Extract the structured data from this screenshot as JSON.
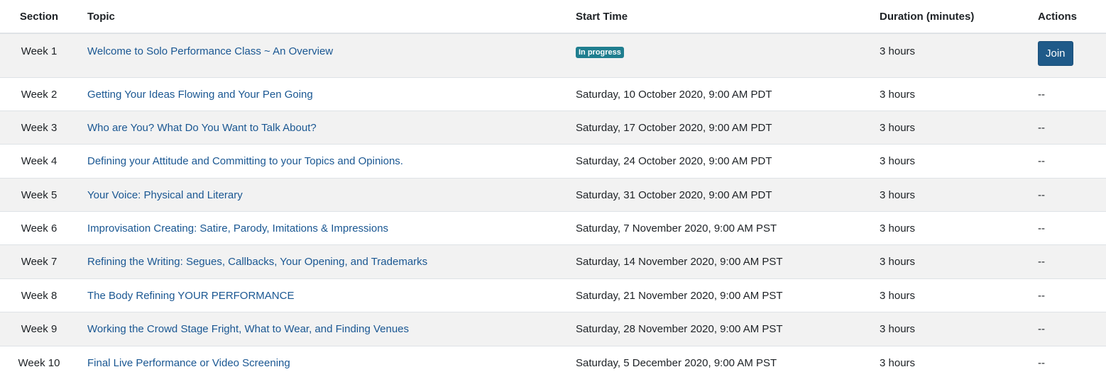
{
  "headers": {
    "section": "Section",
    "topic": "Topic",
    "start_time": "Start Time",
    "duration": "Duration (minutes)",
    "actions": "Actions"
  },
  "status_badge": "In progress",
  "join_label": "Join",
  "colors": {
    "badge": "#1f7e8f",
    "join_button": "#1f5a89",
    "link": "#1a5792"
  },
  "rows": [
    {
      "section": "Week 1",
      "topic": "Welcome to Solo Performance Class ~ An Overview",
      "start": "",
      "duration": "3 hours",
      "action": ""
    },
    {
      "section": "Week 2",
      "topic": "Getting Your Ideas Flowing and Your Pen Going",
      "start": "Saturday, 10 October 2020, 9:00 AM PDT",
      "duration": "3 hours",
      "action": "--"
    },
    {
      "section": "Week 3",
      "topic": "Who are You? What Do You Want to Talk About?",
      "start": "Saturday, 17 October 2020, 9:00 AM PDT",
      "duration": "3 hours",
      "action": "--"
    },
    {
      "section": "Week 4",
      "topic": "Defining your Attitude and Committing to your Topics and Opinions.",
      "start": "Saturday, 24 October 2020, 9:00 AM PDT",
      "duration": "3 hours",
      "action": "--"
    },
    {
      "section": "Week 5",
      "topic": "Your Voice: Physical and Literary",
      "start": "Saturday, 31 October 2020, 9:00 AM PDT",
      "duration": "3 hours",
      "action": "--"
    },
    {
      "section": "Week 6",
      "topic": "Improvisation Creating: Satire, Parody, Imitations & Impressions",
      "start": "Saturday, 7 November 2020, 9:00 AM PST",
      "duration": "3 hours",
      "action": "--"
    },
    {
      "section": "Week 7",
      "topic": "Refining the Writing: Segues, Callbacks, Your Opening, and Trademarks",
      "start": "Saturday, 14 November 2020, 9:00 AM PST",
      "duration": "3 hours",
      "action": "--"
    },
    {
      "section": "Week 8",
      "topic": "The Body Refining YOUR PERFORMANCE",
      "start": "Saturday, 21 November 2020, 9:00 AM PST",
      "duration": "3 hours",
      "action": "--"
    },
    {
      "section": "Week 9",
      "topic": "Working the Crowd Stage Fright, What to Wear, and Finding Venues",
      "start": "Saturday, 28 November 2020, 9:00 AM PST",
      "duration": "3 hours",
      "action": "--"
    },
    {
      "section": "Week 10",
      "topic": "Final Live Performance or Video Screening",
      "start": "Saturday, 5 December 2020, 9:00 AM PST",
      "duration": "3 hours",
      "action": "--"
    }
  ]
}
